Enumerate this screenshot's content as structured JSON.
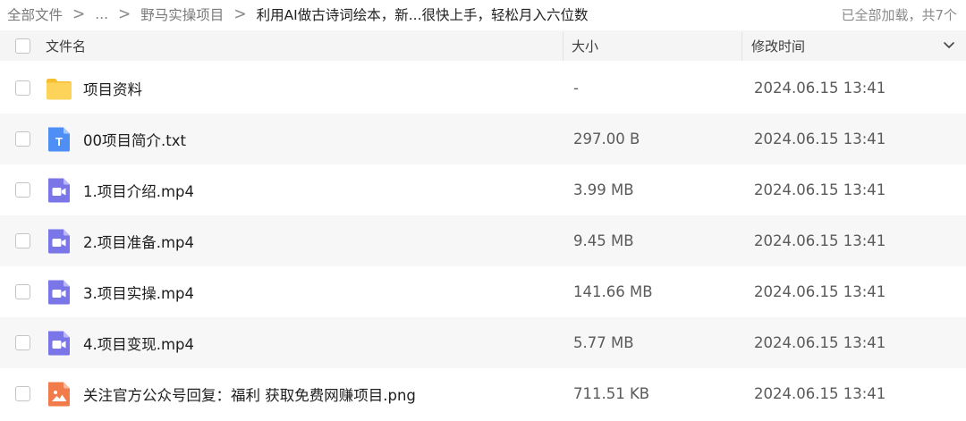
{
  "breadcrumb": {
    "items": [
      "全部文件",
      "...",
      "野马实操项目",
      "利用AI做古诗词绘本，新...很快上手，轻松月入六位数"
    ],
    "separator": ">"
  },
  "status": {
    "loaded_text": "已全部加载，共7个"
  },
  "header": {
    "name_label": "文件名",
    "size_label": "大小",
    "time_label": "修改时间"
  },
  "files": [
    {
      "name": "项目资料",
      "size": "-",
      "time": "2024.06.15 13:41",
      "type": "folder"
    },
    {
      "name": "00项目简介.txt",
      "size": "297.00 B",
      "time": "2024.06.15 13:41",
      "type": "text"
    },
    {
      "name": "1.项目介绍.mp4",
      "size": "3.99 MB",
      "time": "2024.06.15 13:41",
      "type": "video"
    },
    {
      "name": "2.项目准备.mp4",
      "size": "9.45 MB",
      "time": "2024.06.15 13:41",
      "type": "video"
    },
    {
      "name": "3.项目实操.mp4",
      "size": "141.66 MB",
      "time": "2024.06.15 13:41",
      "type": "video"
    },
    {
      "name": "4.项目变现.mp4",
      "size": "5.77 MB",
      "time": "2024.06.15 13:41",
      "type": "video"
    },
    {
      "name": "关注官方公众号回复：福利 获取免费网赚项目.png",
      "size": "711.51 KB",
      "time": "2024.06.15 13:41",
      "type": "image"
    }
  ],
  "icons": {
    "folder": "folder-icon",
    "text": "text-file-icon",
    "video": "video-file-icon",
    "image": "image-file-icon",
    "sort": "chevron-down-icon",
    "separator": "chevron-right-icon"
  },
  "text_icon_letter": "T",
  "colors": {
    "folder": "#fbcd44",
    "text_file": "#4f8ef5",
    "video_file": "#7a76e8",
    "image_file": "#f17b4a",
    "header_bg": "#f5f5f6",
    "alt_row_bg": "#f7f7f8"
  }
}
